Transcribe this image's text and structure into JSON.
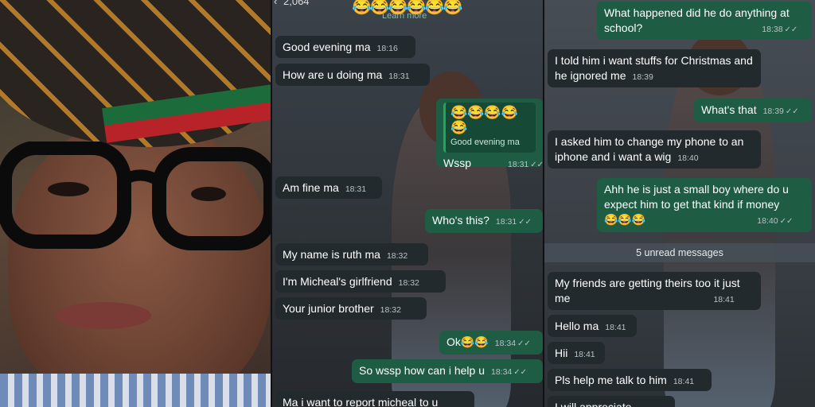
{
  "left_panel": {},
  "middle_chat": {
    "header_partial": "2,064",
    "header_emojis": "😂😂😂😂😂😂",
    "learn_more": "Learn more",
    "messages": [
      {
        "text": "Good evening ma",
        "time": "18:16",
        "dir": "in"
      },
      {
        "text": "How are u doing ma",
        "time": "18:31",
        "dir": "in"
      },
      {
        "quote_emojis": "😂😂😂😂😂",
        "quote_text": "Good evening ma",
        "text": "Wssp",
        "time": "18:31",
        "dir": "out"
      },
      {
        "text": "Am fine ma",
        "time": "18:31",
        "dir": "in"
      },
      {
        "text": "Who's this?",
        "time": "18:31",
        "dir": "out"
      },
      {
        "text": "My name is ruth ma",
        "time": "18:32",
        "dir": "in"
      },
      {
        "text": "I'm Micheal's girlfriend",
        "time": "18:32",
        "dir": "in"
      },
      {
        "text": "Your junior brother",
        "time": "18:32",
        "dir": "in"
      },
      {
        "text": "Ok😂😂",
        "time": "18:34",
        "dir": "out"
      },
      {
        "text": "So wssp how can i help u",
        "time": "18:34",
        "dir": "out"
      },
      {
        "text": "Ma i want to report micheal to u",
        "time": "",
        "dir": "in"
      }
    ]
  },
  "right_chat": {
    "unread_banner": "5 unread messages",
    "messages": [
      {
        "text": "What happened did he do anything at school?",
        "time": "18:38",
        "dir": "out"
      },
      {
        "text": "I told him i want stuffs for Christmas and he ignored me",
        "time": "18:39",
        "dir": "in"
      },
      {
        "text": "What's that",
        "time": "18:39",
        "dir": "out"
      },
      {
        "text": "I asked him to change my phone to an iphone and i want a wig",
        "time": "18:40",
        "dir": "in"
      },
      {
        "text": "Ahh he is just a small boy where do u expect him to get that kind if money",
        "emojis": "😂😂😂",
        "time": "18:40",
        "dir": "out"
      },
      {
        "text": "My friends are getting theirs too it just me",
        "time": "18:41",
        "dir": "in"
      },
      {
        "text": "Hello ma",
        "time": "18:41",
        "dir": "in"
      },
      {
        "text": "Hii",
        "time": "18:41",
        "dir": "in"
      },
      {
        "text": "Pls help me talk to him",
        "time": "18:41",
        "dir": "in"
      },
      {
        "text": "I will appreciate",
        "time": "",
        "dir": "in"
      }
    ]
  },
  "ticks": "✓✓"
}
